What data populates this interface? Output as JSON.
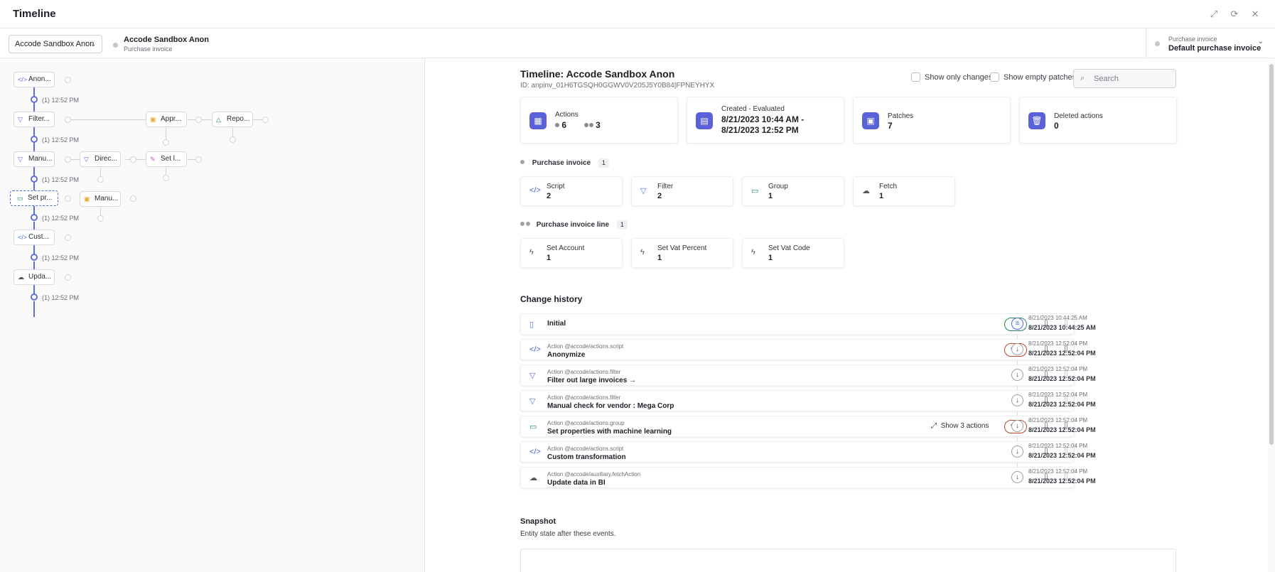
{
  "window": {
    "title": "Timeline",
    "icons": [
      "expand-icon",
      "refresh-icon",
      "close-icon"
    ]
  },
  "entity_bar": {
    "selector_label": "Accode Sandbox Anon",
    "entity_name": "Accode Sandbox Anon",
    "entity_type": "Purchase invoice",
    "ptype_label": "Purchase invoice",
    "ptype_value": "Default purchase invoice"
  },
  "graph": {
    "nodes": [
      {
        "label": "Anon...",
        "icon": "code-icon"
      },
      {
        "label": "Filter...",
        "icon": "filter-icon"
      },
      {
        "label": "Appr...",
        "icon": "clipboard-icon"
      },
      {
        "label": "Repo...",
        "icon": "warning-icon"
      },
      {
        "label": "Manu...",
        "icon": "filter-icon"
      },
      {
        "label": "Direc...",
        "icon": "filter-icon"
      },
      {
        "label": "Set l...",
        "icon": "edit-icon"
      },
      {
        "label": "Set pr...",
        "icon": "folder-icon"
      },
      {
        "label": "Manu...",
        "icon": "clipboard-icon"
      },
      {
        "label": "Cust...",
        "icon": "code-icon"
      },
      {
        "label": "Upda...",
        "icon": "cloud-icon"
      }
    ],
    "times": [
      "(1) 12:52 PM",
      "(1) 12:52 PM",
      "(1) 12:52 PM",
      "(1) 12:52 PM",
      "(1) 12:52 PM",
      "(1) 12:52 PM"
    ]
  },
  "header": {
    "title": "Timeline: Accode Sandbox Anon",
    "id": "ID: anpinv_01H6TGSQH0GGWV0V205J5Y0B84|FPNEYHYX",
    "show_only_changes": "Show only changes",
    "show_empty_patches": "Show empty patches",
    "search_placeholder": "Search"
  },
  "stats": {
    "actions_label": "Actions",
    "actions_single": "6",
    "actions_double": "3",
    "created_label": "Created - Evaluated",
    "created_line1": "8/21/2023 10:44 AM -",
    "created_line2": "8/21/2023 12:52 PM",
    "patches_label": "Patches",
    "patches_value": "7",
    "deleted_label": "Deleted actions",
    "deleted_value": "0"
  },
  "purchase_invoice": {
    "title": "Purchase invoice",
    "count": "1",
    "cards": [
      {
        "label": "Script",
        "value": "2",
        "icon": "code-icon"
      },
      {
        "label": "Filter",
        "value": "2",
        "icon": "filter-icon"
      },
      {
        "label": "Group",
        "value": "1",
        "icon": "folder-icon"
      },
      {
        "label": "Fetch",
        "value": "1",
        "icon": "cloud-icon"
      }
    ]
  },
  "purchase_invoice_line": {
    "title": "Purchase invoice line",
    "count": "1",
    "cards": [
      {
        "label": "Set Account",
        "value": "1",
        "icon": "bolt-icon"
      },
      {
        "label": "Set Vat Percent",
        "value": "1",
        "icon": "bolt-icon"
      },
      {
        "label": "Set Vat Code",
        "value": "1",
        "icon": "bolt-icon"
      }
    ]
  },
  "change_history": {
    "title": "Change history",
    "show_actions": "Show 3 actions",
    "rows": [
      {
        "sub": "",
        "name": "Initial",
        "icon": "document-icon",
        "badge": "+ 3",
        "t1": "8/21/2023 10:44:25 AM",
        "t2": "8/21/2023 10:44:25 AM"
      },
      {
        "sub": "Action @accode/actions.script",
        "name": "Anonymize",
        "icon": "code-icon",
        "badge": "1",
        "t1": "8/21/2023 12:52:04 PM",
        "t2": "8/21/2023 12:52:04 PM"
      },
      {
        "sub": "Action @accode/actions.filter",
        "name": "Filter out large invoices →",
        "icon": "filter-icon",
        "badge": "",
        "t1": "8/21/2023 12:52:04 PM",
        "t2": "8/21/2023 12:52:04 PM"
      },
      {
        "sub": "Action @accode/actions.filter",
        "name": "Manual check for vendor : Mega Corp",
        "icon": "filter-icon",
        "badge": "",
        "t1": "8/21/2023 12:52:04 PM",
        "t2": "8/21/2023 12:52:04 PM"
      },
      {
        "sub": "Action @accode/actions.group",
        "name": "Set properties with machine learning",
        "icon": "folder-icon",
        "badge": "3",
        "t1": "8/21/2023 12:52:04 PM",
        "t2": "8/21/2023 12:52:04 PM"
      },
      {
        "sub": "Action @accode/actions.script",
        "name": "Custom transformation",
        "icon": "code-icon",
        "badge": "",
        "t1": "8/21/2023 12:52:04 PM",
        "t2": "8/21/2023 12:52:04 PM"
      },
      {
        "sub": "Action @accode/auxiliary.fetchAction",
        "name": "Update data in BI",
        "icon": "cloud-icon",
        "badge": "",
        "t1": "8/21/2023 12:52:04 PM",
        "t2": "8/21/2023 12:52:04 PM"
      }
    ]
  },
  "snapshot": {
    "title": "Snapshot",
    "subtitle": "Entity state after these events."
  },
  "colors": {
    "accent": "#5b61d9",
    "graph_line": "#5b6fd8",
    "badge_added": "#1f8a5b",
    "badge_modified": "#b24a2a"
  }
}
